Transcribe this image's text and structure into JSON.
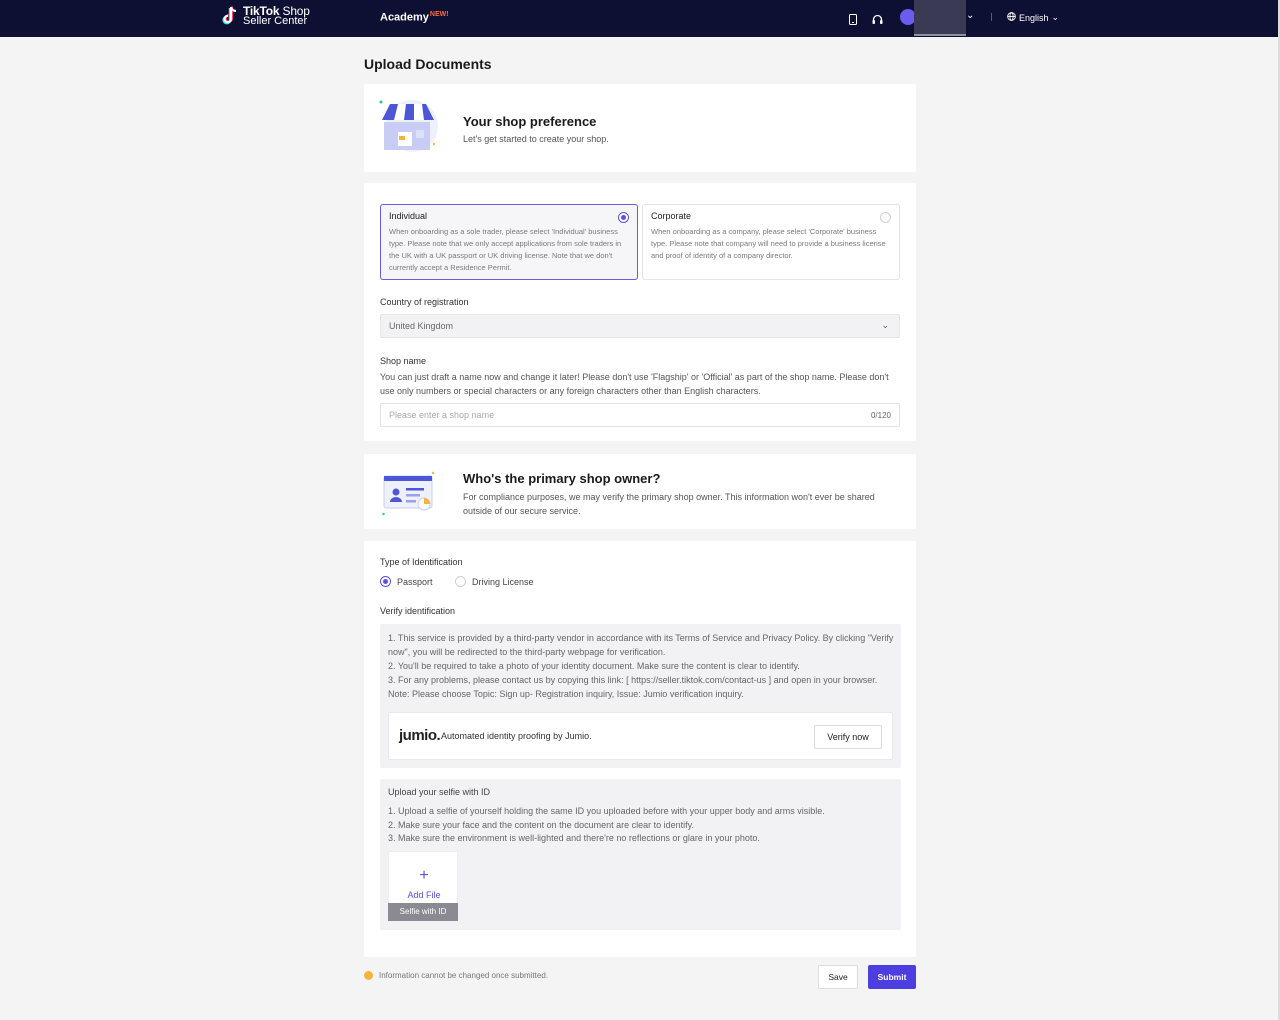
{
  "header": {
    "brand_line1_bold": "TikTok",
    "brand_line1": " Shop",
    "brand_line2": "Seller Center",
    "academy_label": "Academy",
    "academy_badge": "NEW!",
    "language": "English"
  },
  "page_title": "Upload Documents",
  "shop_preference": {
    "title": "Your shop preference",
    "subtitle": "Let's get started to create your shop."
  },
  "business_type": {
    "options": [
      {
        "label": "Individual",
        "description": "When onboarding as a sole trader, please select 'Individual' business type. Please note that we only accept applications from sole traders in the UK with a UK passport or UK driving license. Note that we don't currently accept a Residence Permit.",
        "selected": true
      },
      {
        "label": "Corporate",
        "description": "When onboarding as a company, please select 'Corporate' business type. Please note that company will need to provide a business license and proof of identity of a company director.",
        "selected": false
      }
    ]
  },
  "country": {
    "label": "Country of registration",
    "value": "United Kingdom"
  },
  "shop_name": {
    "label": "Shop name",
    "help": "You can just draft a name now and change it later! Please don't use 'Flagship' or 'Official' as part of the shop name. Please don't use only numbers or special characters or any foreign characters other than English characters.",
    "placeholder": "Please enter a shop name",
    "counter": "0/120"
  },
  "owner": {
    "title": "Who's the primary shop owner?",
    "subtitle": "For compliance purposes, we may verify the primary shop owner. This information won't ever be shared outside of our secure service."
  },
  "identification": {
    "label": "Type of Identification",
    "options": [
      {
        "label": "Passport",
        "selected": true
      },
      {
        "label": "Driving License",
        "selected": false
      }
    ]
  },
  "verify": {
    "label": "Verify identification",
    "instructions": [
      "1. This service is provided by a third-party vendor in accordance with its Terms of Service and Privacy Policy. By clicking \"Verify now\", you will be redirected to the third-party webpage for verification.",
      "2. You'll be required to take a photo of your identity document. Make sure the content is clear to identify.",
      "3. For any problems, please contact us by copying this link: [ https://seller.tiktok.com/contact-us ] and open in your browser.",
      "Note: Please choose Topic: Sign up- Registration inquiry, Issue: Jumio verification inquiry."
    ],
    "jumio_logo": "jumio.",
    "jumio_text": "Automated identity proofing by Jumio.",
    "button": "Verify now"
  },
  "selfie": {
    "label": "Upload your selfie with ID",
    "instructions": [
      "1. Upload a selfie of yourself holding the same ID you uploaded before with your upper body and arms visible.",
      "2. Make sure your face and the content on the document are clear to identify.",
      "3. Make sure the environment is well-lighted and there're no reflections or glare in your photo."
    ],
    "add_file": "Add File",
    "caption": "Selfie with ID"
  },
  "footer": {
    "note": "Information cannot be changed once submitted.",
    "save": "Save",
    "submit": "Submit"
  },
  "colors": {
    "accent": "#4d3ee0",
    "header": "#0e1033",
    "warning": "#f5b53b"
  }
}
